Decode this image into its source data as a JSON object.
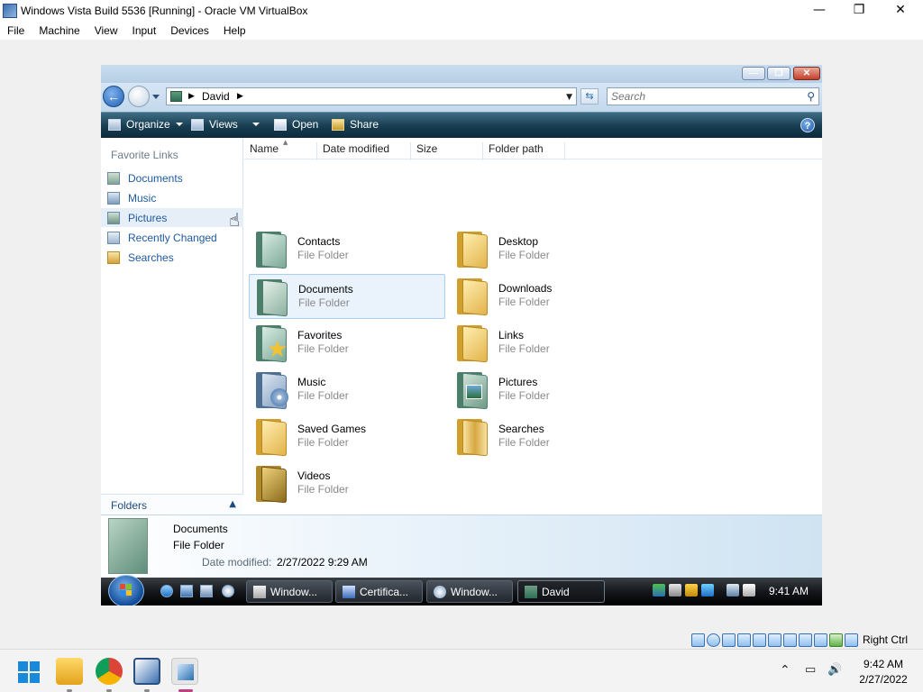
{
  "host": {
    "window_title": "Windows Vista Build 5536 [Running] - Oracle VM VirtualBox",
    "menu": [
      "File",
      "Machine",
      "View",
      "Input",
      "Devices",
      "Help"
    ],
    "controls": {
      "minimize": "—",
      "restore": "❐",
      "close": "✕"
    },
    "statusbar": {
      "host_key": "Right Ctrl"
    },
    "taskbar": {
      "apps": [
        "start-icon",
        "file-explorer-icon",
        "chrome-icon",
        "virtualbox-icon",
        "vista-vm-icon"
      ],
      "time": "9:42 AM",
      "date": "2/27/2022"
    }
  },
  "explorer": {
    "address": {
      "path": "David"
    },
    "search": {
      "placeholder": "Search"
    },
    "toolbar": {
      "organize": "Organize",
      "views": "Views",
      "open": "Open",
      "share": "Share"
    },
    "sidebar": {
      "heading": "Favorite Links",
      "items": [
        {
          "label": "Documents"
        },
        {
          "label": "Music"
        },
        {
          "label": "Pictures"
        },
        {
          "label": "Recently Changed"
        },
        {
          "label": "Searches"
        }
      ],
      "folders_label": "Folders"
    },
    "columns": [
      "Name",
      "Date modified",
      "Size",
      "Folder path"
    ],
    "items": [
      {
        "name": "Contacts",
        "type": "File Folder"
      },
      {
        "name": "Desktop",
        "type": "File Folder"
      },
      {
        "name": "Documents",
        "type": "File Folder"
      },
      {
        "name": "Downloads",
        "type": "File Folder"
      },
      {
        "name": "Favorites",
        "type": "File Folder"
      },
      {
        "name": "Links",
        "type": "File Folder"
      },
      {
        "name": "Music",
        "type": "File Folder"
      },
      {
        "name": "Pictures",
        "type": "File Folder"
      },
      {
        "name": "Saved Games",
        "type": "File Folder"
      },
      {
        "name": "Searches",
        "type": "File Folder"
      },
      {
        "name": "Videos",
        "type": "File Folder"
      }
    ],
    "details": {
      "name": "Documents",
      "type": "File Folder",
      "date_label": "Date modified:",
      "date_value": "2/27/2022 9:29 AM"
    }
  },
  "vista_taskbar": {
    "buttons": [
      {
        "label": "Window..."
      },
      {
        "label": "Certifica..."
      },
      {
        "label": "Window..."
      },
      {
        "label": "David"
      }
    ],
    "clock": "9:41 AM"
  }
}
